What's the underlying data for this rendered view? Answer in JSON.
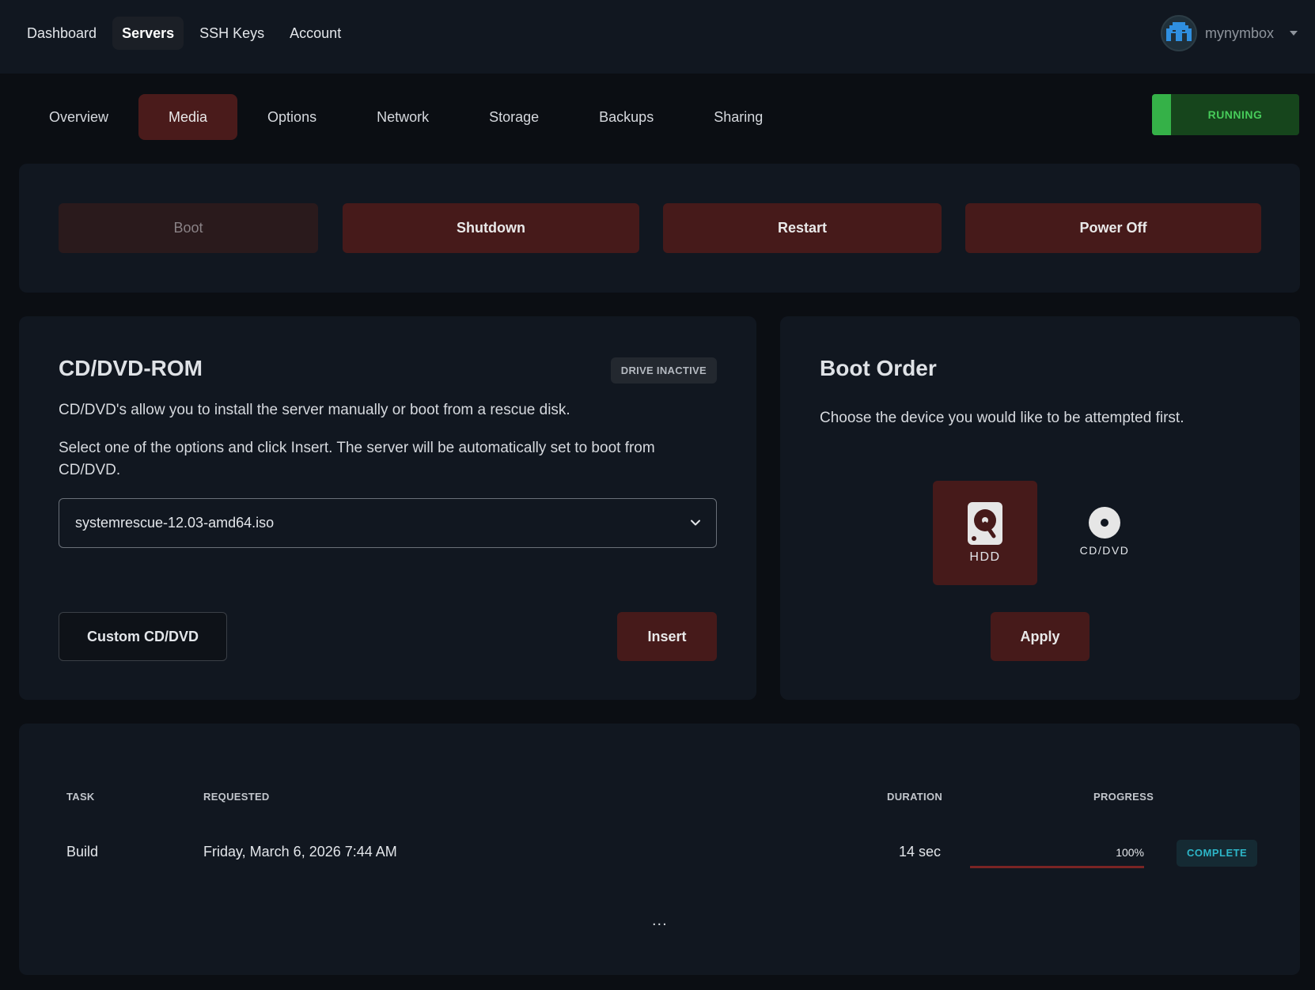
{
  "topnav": {
    "items": [
      {
        "label": "Dashboard",
        "active": false
      },
      {
        "label": "Servers",
        "active": true
      },
      {
        "label": "SSH Keys",
        "active": false
      },
      {
        "label": "Account",
        "active": false
      }
    ],
    "username": "mynymbox"
  },
  "subtabs": [
    {
      "label": "Overview",
      "active": false
    },
    {
      "label": "Media",
      "active": true
    },
    {
      "label": "Options",
      "active": false
    },
    {
      "label": "Network",
      "active": false
    },
    {
      "label": "Storage",
      "active": false
    },
    {
      "label": "Backups",
      "active": false
    },
    {
      "label": "Sharing",
      "active": false
    }
  ],
  "status": {
    "label": "RUNNING",
    "color": "#47cc5a"
  },
  "power": {
    "boot": "Boot",
    "shutdown": "Shutdown",
    "restart": "Restart",
    "poweroff": "Power Off"
  },
  "cdrom": {
    "title": "CD/DVD-ROM",
    "badge": "DRIVE INACTIVE",
    "desc1": "CD/DVD's allow you to install the server manually or boot from a rescue disk.",
    "desc2": "Select one of the options and click Insert. The server will be automatically set to boot from CD/DVD.",
    "selected_iso": "systemrescue-12.03-amd64.iso",
    "custom_label": "Custom CD/DVD",
    "insert_label": "Insert"
  },
  "boot_order": {
    "title": "Boot Order",
    "desc": "Choose the device you would like to be attempted first.",
    "hdd_label": "HDD",
    "cd_label": "CD/DVD",
    "selected": "HDD",
    "apply_label": "Apply"
  },
  "tasks": {
    "headers": {
      "task": "TASK",
      "requested": "REQUESTED",
      "duration": "DURATION",
      "progress": "PROGRESS"
    },
    "rows": [
      {
        "task": "Build",
        "requested": "Friday, March 6, 2026 7:44 AM",
        "duration": "14 sec",
        "progress": "100%",
        "progress_value": 1.0,
        "status": "COMPLETE"
      }
    ],
    "more": "..."
  },
  "colors": {
    "accent": "#461a1a",
    "running": "#16451c",
    "complete": "#2db6c8"
  }
}
